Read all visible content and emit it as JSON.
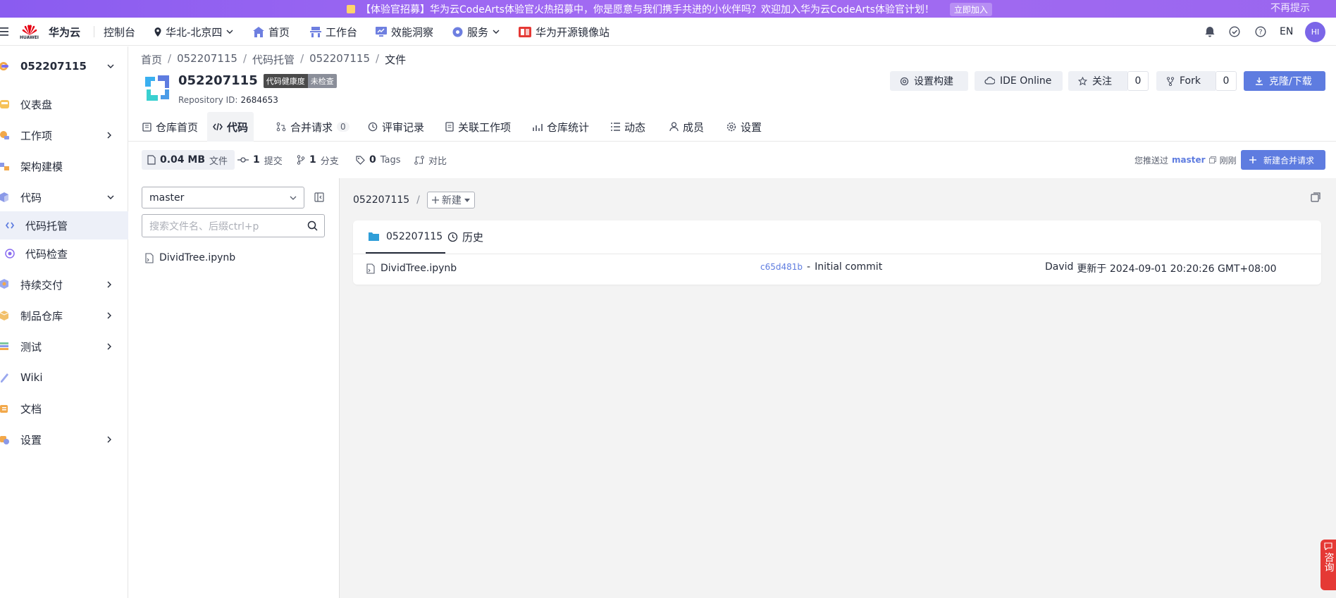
{
  "banner": {
    "message": "【体验官招募】华为云CodeArts体验官火热招募中，你是愿意与我们携手共进的小伙伴吗？欢迎加入华为云CodeArts体验官计划！",
    "join_label": "立即加入",
    "dismiss_label": "不再提示"
  },
  "topnav": {
    "brand_logo_text": "HUAWEI",
    "brand": "华为云",
    "console": "控制台",
    "region": "华北-北京四",
    "home": "首页",
    "workbench": "工作台",
    "insight": "效能洞察",
    "services": "服务",
    "mirror": "华为开源镜像站",
    "lang": "EN",
    "avatar": "HI"
  },
  "sidebar": {
    "project": "052207115",
    "items": [
      {
        "label": "仪表盘",
        "icon": "dashboard-icon"
      },
      {
        "label": "工作项",
        "icon": "workitem-icon",
        "expandable": true
      },
      {
        "label": "架构建模",
        "icon": "architecture-icon"
      },
      {
        "label": "代码",
        "icon": "code-icon",
        "expanded": true
      },
      {
        "label": "代码托管",
        "icon": "code-hosting-icon",
        "sub": true,
        "active": true
      },
      {
        "label": "代码检查",
        "icon": "code-check-icon",
        "sub": true
      },
      {
        "label": "持续交付",
        "icon": "delivery-icon",
        "expandable": true
      },
      {
        "label": "制品仓库",
        "icon": "artifact-icon",
        "expandable": true
      },
      {
        "label": "测试",
        "icon": "test-icon",
        "expandable": true
      },
      {
        "label": "Wiki",
        "icon": "wiki-icon"
      },
      {
        "label": "文档",
        "icon": "docs-icon"
      },
      {
        "label": "设置",
        "icon": "settings-icon",
        "expandable": true
      }
    ]
  },
  "breadcrumb": [
    "首页",
    "052207115",
    "代码托管",
    "052207115",
    "文件"
  ],
  "repo": {
    "name": "052207115",
    "health_label": "代码健康度",
    "health_status": "未检查",
    "id_label": "Repository ID:",
    "id": "2684653"
  },
  "actions": {
    "build": "设置构建",
    "ide": "IDE Online",
    "follow": "关注",
    "follow_count": "0",
    "fork": "Fork",
    "fork_count": "0",
    "clone": "克隆/下载"
  },
  "tabs": [
    {
      "label": "仓库首页"
    },
    {
      "label": "代码"
    },
    {
      "label": "合并请求",
      "count": "0"
    },
    {
      "label": "评审记录"
    },
    {
      "label": "关联工作项"
    },
    {
      "label": "仓库统计"
    },
    {
      "label": "动态"
    },
    {
      "label": "成员"
    },
    {
      "label": "设置"
    }
  ],
  "stats": {
    "size": "0.04 MB",
    "size_label": "文件",
    "commits": "1",
    "commits_label": "提交",
    "branches": "1",
    "branches_label": "分支",
    "tags": "0",
    "tags_label": "Tags",
    "compare": "对比"
  },
  "push": {
    "prefix": "您推送过",
    "branch": "master",
    "time": "刚刚",
    "new_mr": "新建合并请求"
  },
  "filetree": {
    "branch": "master",
    "search_placeholder": "搜索文件名、后缀ctrl+p",
    "files": [
      "DividTree.ipynb"
    ]
  },
  "main": {
    "path": "052207115",
    "path_sep": "/",
    "new_label": "新建",
    "tab_folder": "052207115",
    "tab_history": "历史",
    "rows": [
      {
        "name": "DividTree.ipynb",
        "commit": "c65d481b",
        "dash": "-",
        "message": "Initial commit",
        "author": "David",
        "updated": "更新于 2024-09-01 20:20:26 GMT+08:00"
      }
    ]
  },
  "consult": "咨询",
  "colors": {
    "accent": "#5e7ce0",
    "banner": "#9a66ef",
    "brand_red": "#e60012"
  }
}
